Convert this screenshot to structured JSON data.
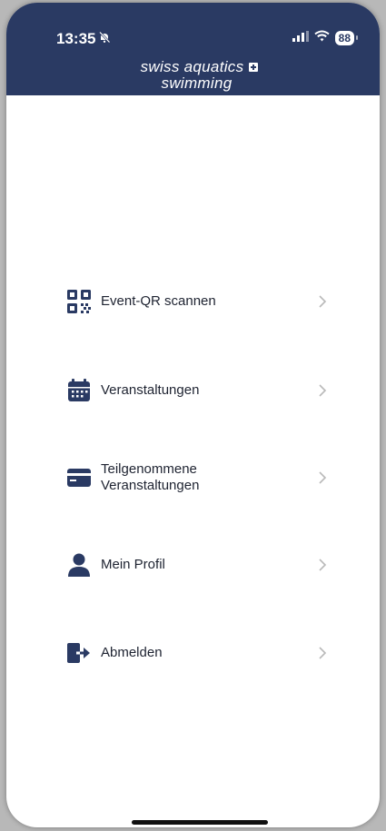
{
  "status_bar": {
    "time": "13:35",
    "battery": "88",
    "icons": [
      "muted-bell-icon",
      "cellular-signal-icon",
      "wifi-icon",
      "battery-icon"
    ]
  },
  "brand": {
    "line1": "swiss aquatics",
    "line2": "swimming"
  },
  "menu": {
    "items": [
      {
        "label": "Event-QR scannen",
        "icon": "qr-code-icon"
      },
      {
        "label": "Veranstaltungen",
        "icon": "calendar-icon"
      },
      {
        "label": "Teilgenommene\nVeranstaltungen",
        "icon": "card-icon"
      },
      {
        "label": "Mein Profil",
        "icon": "user-icon"
      },
      {
        "label": "Abmelden",
        "icon": "logout-icon"
      }
    ]
  },
  "colors": {
    "header_bg": "#2a3a63",
    "icon": "#2a3a63",
    "chevron": "#b9b9b9",
    "text": "#1e2331"
  }
}
